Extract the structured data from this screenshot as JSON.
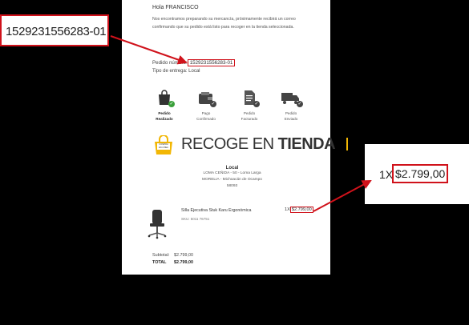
{
  "email": {
    "greeting": "Hola FRANCISCO",
    "intro": "Nos encontramos preparando su mercancía, próximamente recibirá un correo confirmando que su pedido está listo para recoger en la tienda seleccionada.",
    "order_label": "Pedido número:",
    "order_number": "1529231556283-01",
    "delivery": "Tipo de entrega: Local",
    "steps": [
      {
        "line1": "Pedido",
        "line2": "Realizado",
        "icon": "bag-check-icon"
      },
      {
        "line1": "Pago",
        "line2": "Confirmado",
        "icon": "wallet-check-icon"
      },
      {
        "line1": "Pedido",
        "line2": "Facturado",
        "icon": "document-check-icon"
      },
      {
        "line1": "Pedido",
        "line2": "Enviado",
        "icon": "truck-check-icon"
      }
    ],
    "banner": {
      "bag_line1": "COMPRA",
      "bag_line2": "EN LÍNEA",
      "text_light": "RECOGE EN",
      "text_bold": "TIENDA"
    },
    "store": {
      "name": "Local",
      "line1": "LOMA CEÑIDA - 50 - Loma Larga",
      "line2": "MORELIA - Michoacán de Ocampo",
      "line3": "58093"
    },
    "product": {
      "name": "Silla Ejecutiva Stuk Karu Ergonómica",
      "sku": "SKU: 5011 76751",
      "qty": "1X",
      "price": "$2.799,00"
    },
    "totals": {
      "subtotal_label": "Subtotal:",
      "subtotal_value": "$2.799,00",
      "total_label": "TOTAL",
      "total_value": "$2.799,00"
    }
  },
  "callouts": {
    "order_number": "1529231556283-01",
    "qty": "1X",
    "price": "$2.799,00"
  },
  "colors": {
    "highlight": "#d0121b",
    "accent": "#f2b705",
    "check_green": "#3aa03a",
    "check_dark": "#444444"
  }
}
